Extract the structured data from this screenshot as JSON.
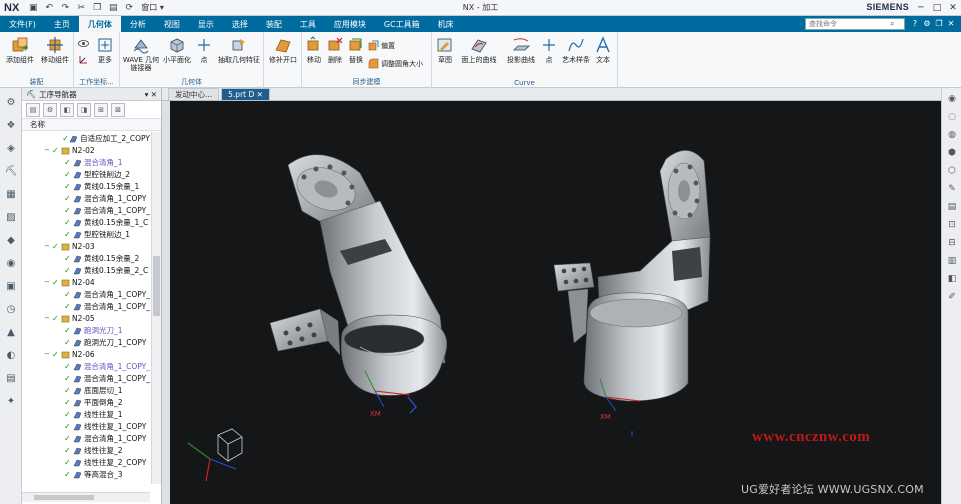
{
  "titlebar": {
    "logo": "NX",
    "window_menu": "窗口 ▾",
    "title": "NX - 加工",
    "brand": "SIEMENS",
    "controls": [
      "─",
      "□",
      "✕"
    ]
  },
  "menubar": {
    "tabs": [
      "文件(F)",
      "主页",
      "几何体",
      "分析",
      "视图",
      "显示",
      "选择",
      "装配",
      "工具",
      "应用模块",
      "GC工具箱",
      "机床"
    ],
    "active_index": 2,
    "search_placeholder": "查找命令"
  },
  "ribbon": {
    "groups": [
      {
        "label": "装配"
      },
      {
        "label": "工作坐标..."
      },
      {
        "label": "几何体"
      },
      {
        "label": "同步建模"
      },
      {
        "label": "Curve"
      }
    ],
    "buttons": {
      "add_component": "添加组件",
      "move_component": "移动组件",
      "more": "更多",
      "wave": "WAVE 几何链接器",
      "face_normal": "小平面化",
      "point": "点",
      "extract": "抽取几何特征",
      "trim": "修补开口",
      "move": "移动",
      "delete": "删除",
      "replace": "替换",
      "offset": "偏置",
      "resize_blend": "调整圆角大小",
      "sketch": "草图",
      "curve_on_face": "面上的曲线",
      "project_curve": "投影曲线",
      "point2": "点",
      "art_spline": "艺术样条",
      "text": "文本"
    }
  },
  "navigator": {
    "title": "工序导航器",
    "column": "名称",
    "rows": [
      {
        "indent": 2,
        "text": "自适应加工_2_COPY",
        "type": "op",
        "hl": false
      },
      {
        "indent": 1,
        "text": "N2-02",
        "type": "grp",
        "hl": false
      },
      {
        "indent": 2,
        "text": "混合清角_1",
        "type": "op",
        "hl": true
      },
      {
        "indent": 2,
        "text": "型腔铣削边_2",
        "type": "op",
        "hl": false
      },
      {
        "indent": 2,
        "text": "黄线0.15余量_1",
        "type": "op",
        "hl": false
      },
      {
        "indent": 2,
        "text": "混合清角_1_COPY",
        "type": "op",
        "hl": false
      },
      {
        "indent": 2,
        "text": "混合清角_1_COPY_",
        "type": "op",
        "hl": false
      },
      {
        "indent": 2,
        "text": "黄线0.15余量_1_C",
        "type": "op",
        "hl": false
      },
      {
        "indent": 2,
        "text": "型腔铣削边_1",
        "type": "op",
        "hl": false
      },
      {
        "indent": 1,
        "text": "N2-03",
        "type": "grp",
        "hl": false
      },
      {
        "indent": 2,
        "text": "黄线0.15余量_2",
        "type": "op",
        "hl": false
      },
      {
        "indent": 2,
        "text": "黄线0.15余量_2_C",
        "type": "op",
        "hl": false
      },
      {
        "indent": 1,
        "text": "N2-04",
        "type": "grp",
        "hl": false
      },
      {
        "indent": 2,
        "text": "混合清角_1_COPY_",
        "type": "op",
        "hl": false
      },
      {
        "indent": 2,
        "text": "混合清角_1_COPY_",
        "type": "op",
        "hl": false
      },
      {
        "indent": 1,
        "text": "N2-05",
        "type": "grp",
        "hl": false
      },
      {
        "indent": 2,
        "text": "跑洞光刀_1",
        "type": "op",
        "hl": true
      },
      {
        "indent": 2,
        "text": "跑洞光刀_1_COPY",
        "type": "op",
        "hl": false
      },
      {
        "indent": 1,
        "text": "N2-06",
        "type": "grp",
        "hl": false
      },
      {
        "indent": 2,
        "text": "混合清角_1_COPY_",
        "type": "op",
        "hl": true
      },
      {
        "indent": 2,
        "text": "混合清角_1_COPY_",
        "type": "op",
        "hl": false
      },
      {
        "indent": 2,
        "text": "底面层切_1",
        "type": "op",
        "hl": false
      },
      {
        "indent": 2,
        "text": "平面倒角_2",
        "type": "op",
        "hl": false
      },
      {
        "indent": 2,
        "text": "线性往复_1",
        "type": "op",
        "hl": false
      },
      {
        "indent": 2,
        "text": "线性往复_1_COPY",
        "type": "op",
        "hl": false
      },
      {
        "indent": 2,
        "text": "混合清角_1_COPY",
        "type": "op",
        "hl": false
      },
      {
        "indent": 2,
        "text": "线性往复_2",
        "type": "op",
        "hl": false
      },
      {
        "indent": 2,
        "text": "线性往复_2_COPY",
        "type": "op",
        "hl": false
      },
      {
        "indent": 2,
        "text": "等高混合_3",
        "type": "op",
        "hl": false
      }
    ]
  },
  "doc_tabs": [
    "发动中心...",
    "5.prt D ✕"
  ],
  "viewport": {
    "csys_label_1": "XM",
    "csys_label_2": "XM"
  },
  "watermarks": {
    "red": "www.cncznw.com",
    "footer": "UG爱好者论坛 WWW.UGSNX.COM"
  },
  "colors": {
    "accent": "#006b9f",
    "viewport_bg": "#141618",
    "check": "#1a8a1a",
    "highlight_text": "#6b4fc4"
  }
}
